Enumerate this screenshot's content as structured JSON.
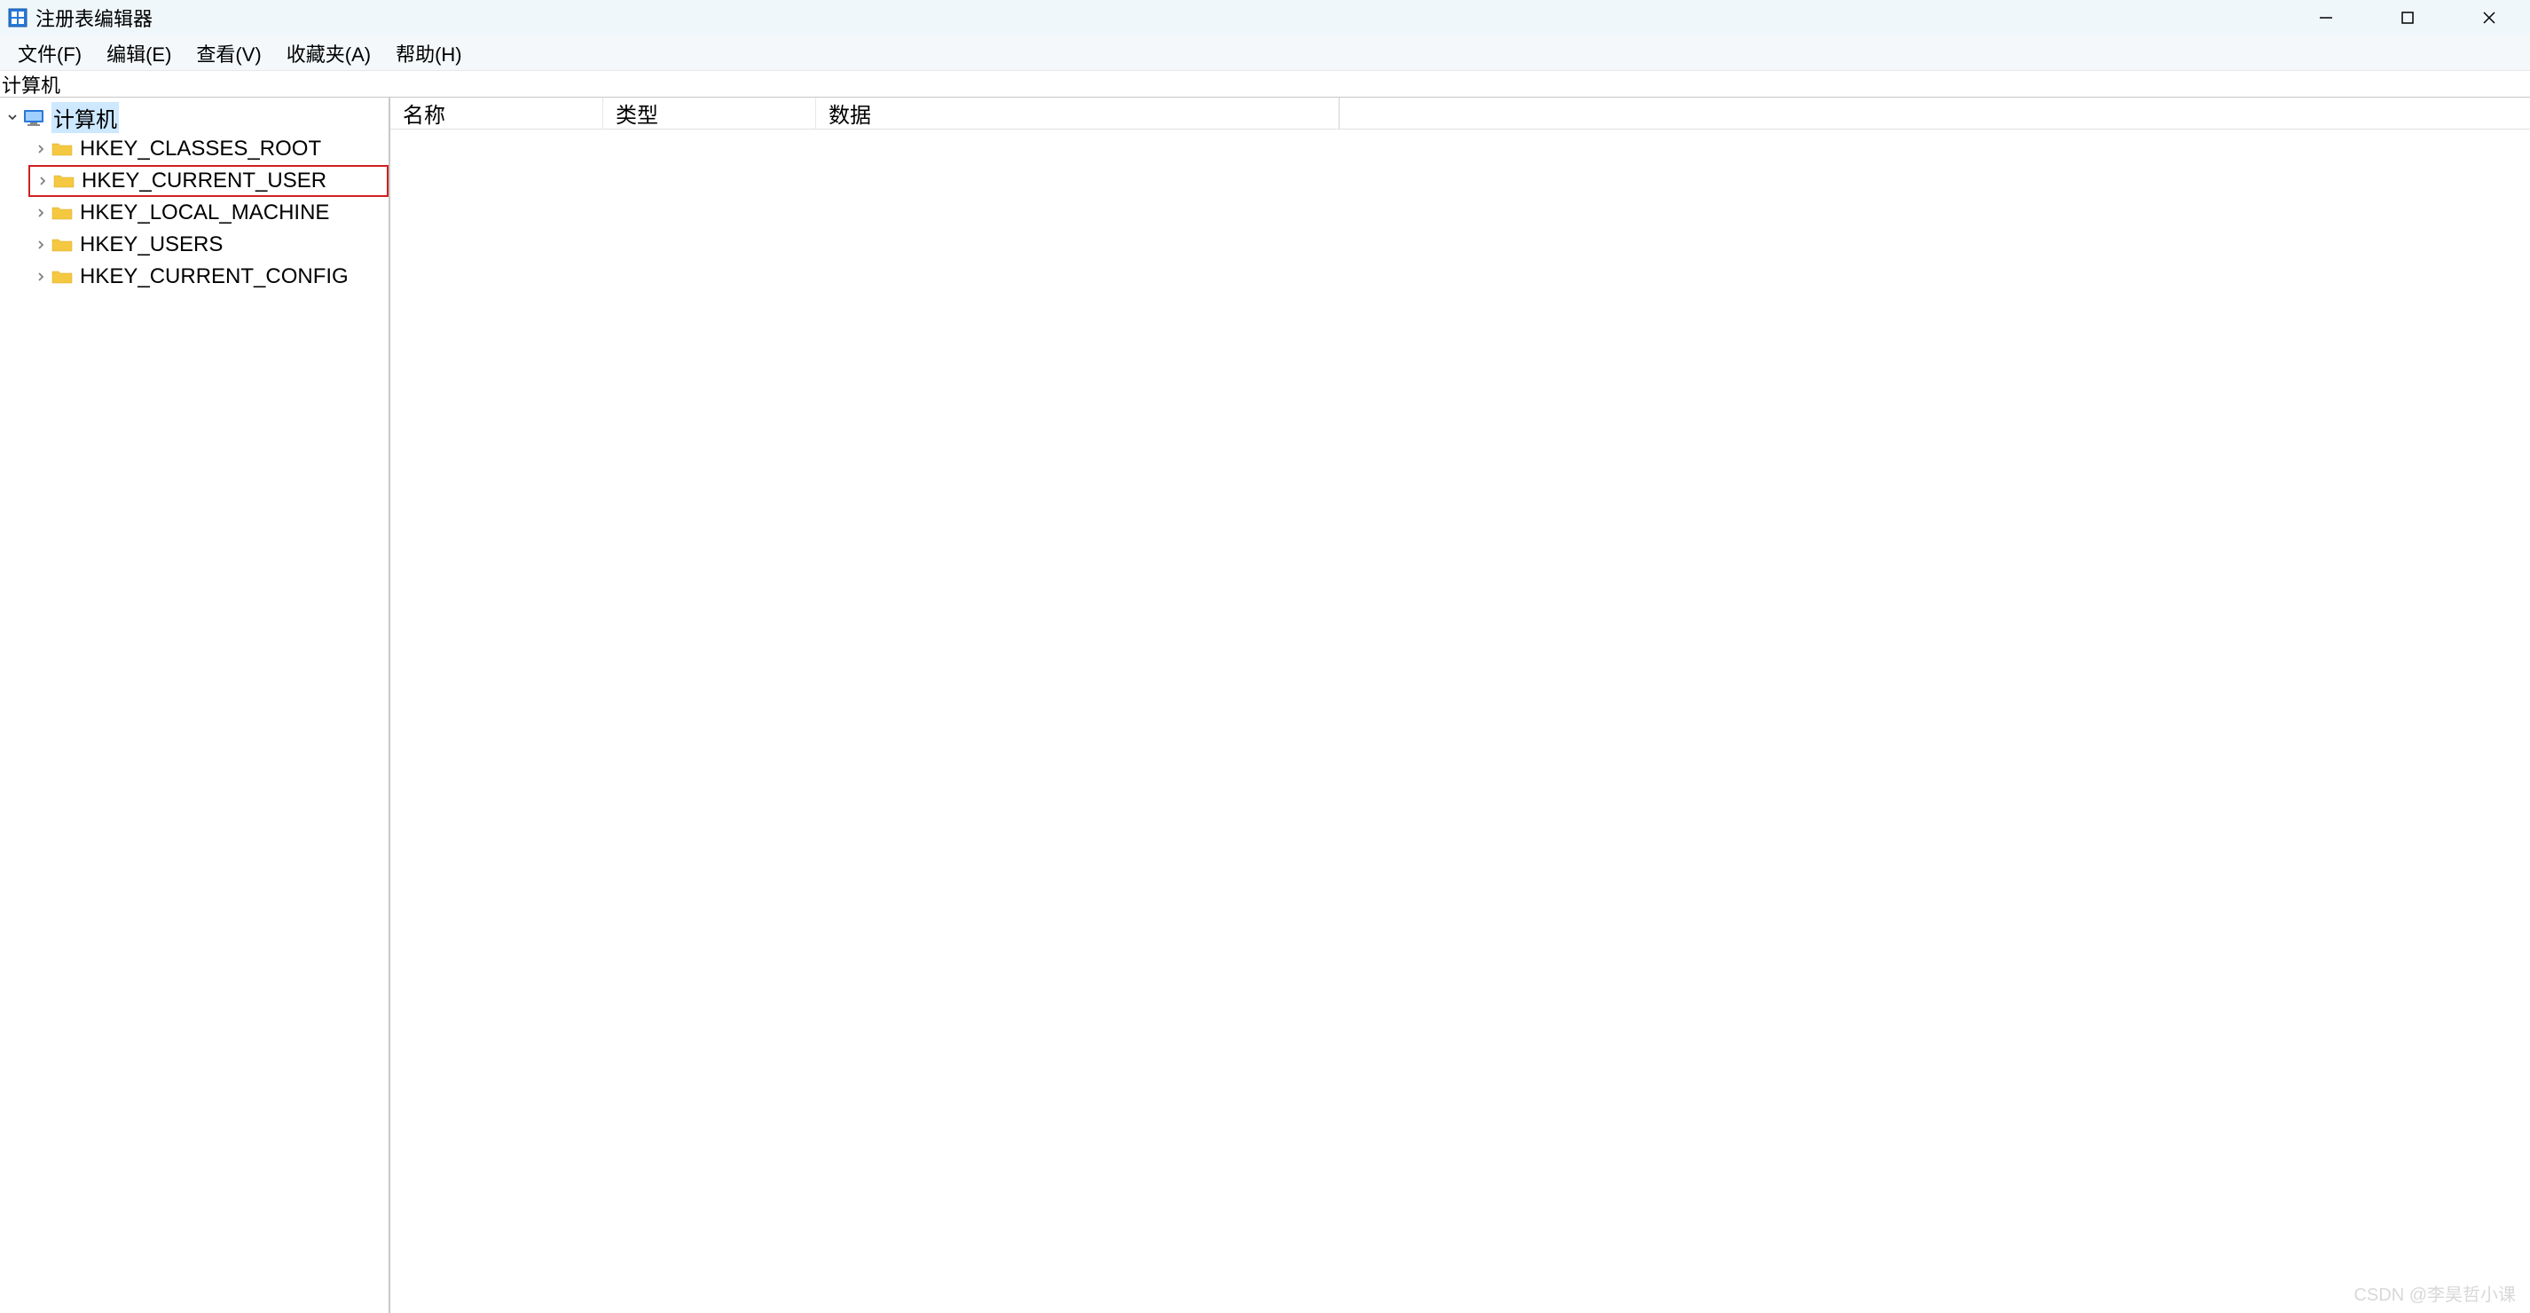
{
  "window": {
    "title": "注册表编辑器"
  },
  "menubar": {
    "items": [
      {
        "label": "文件(F)"
      },
      {
        "label": "编辑(E)"
      },
      {
        "label": "查看(V)"
      },
      {
        "label": "收藏夹(A)"
      },
      {
        "label": "帮助(H)"
      }
    ]
  },
  "addressbar": {
    "path": "计算机"
  },
  "tree": {
    "root": {
      "label": "计算机",
      "expanded": true,
      "selected": true,
      "children": [
        {
          "label": "HKEY_CLASSES_ROOT",
          "highlighted": false
        },
        {
          "label": "HKEY_CURRENT_USER",
          "highlighted": true
        },
        {
          "label": "HKEY_LOCAL_MACHINE",
          "highlighted": false
        },
        {
          "label": "HKEY_USERS",
          "highlighted": false
        },
        {
          "label": "HKEY_CURRENT_CONFIG",
          "highlighted": false
        }
      ]
    }
  },
  "list": {
    "columns": [
      {
        "label": "名称"
      },
      {
        "label": "类型"
      },
      {
        "label": "数据"
      }
    ]
  },
  "watermark": "CSDN @李昊哲小课"
}
